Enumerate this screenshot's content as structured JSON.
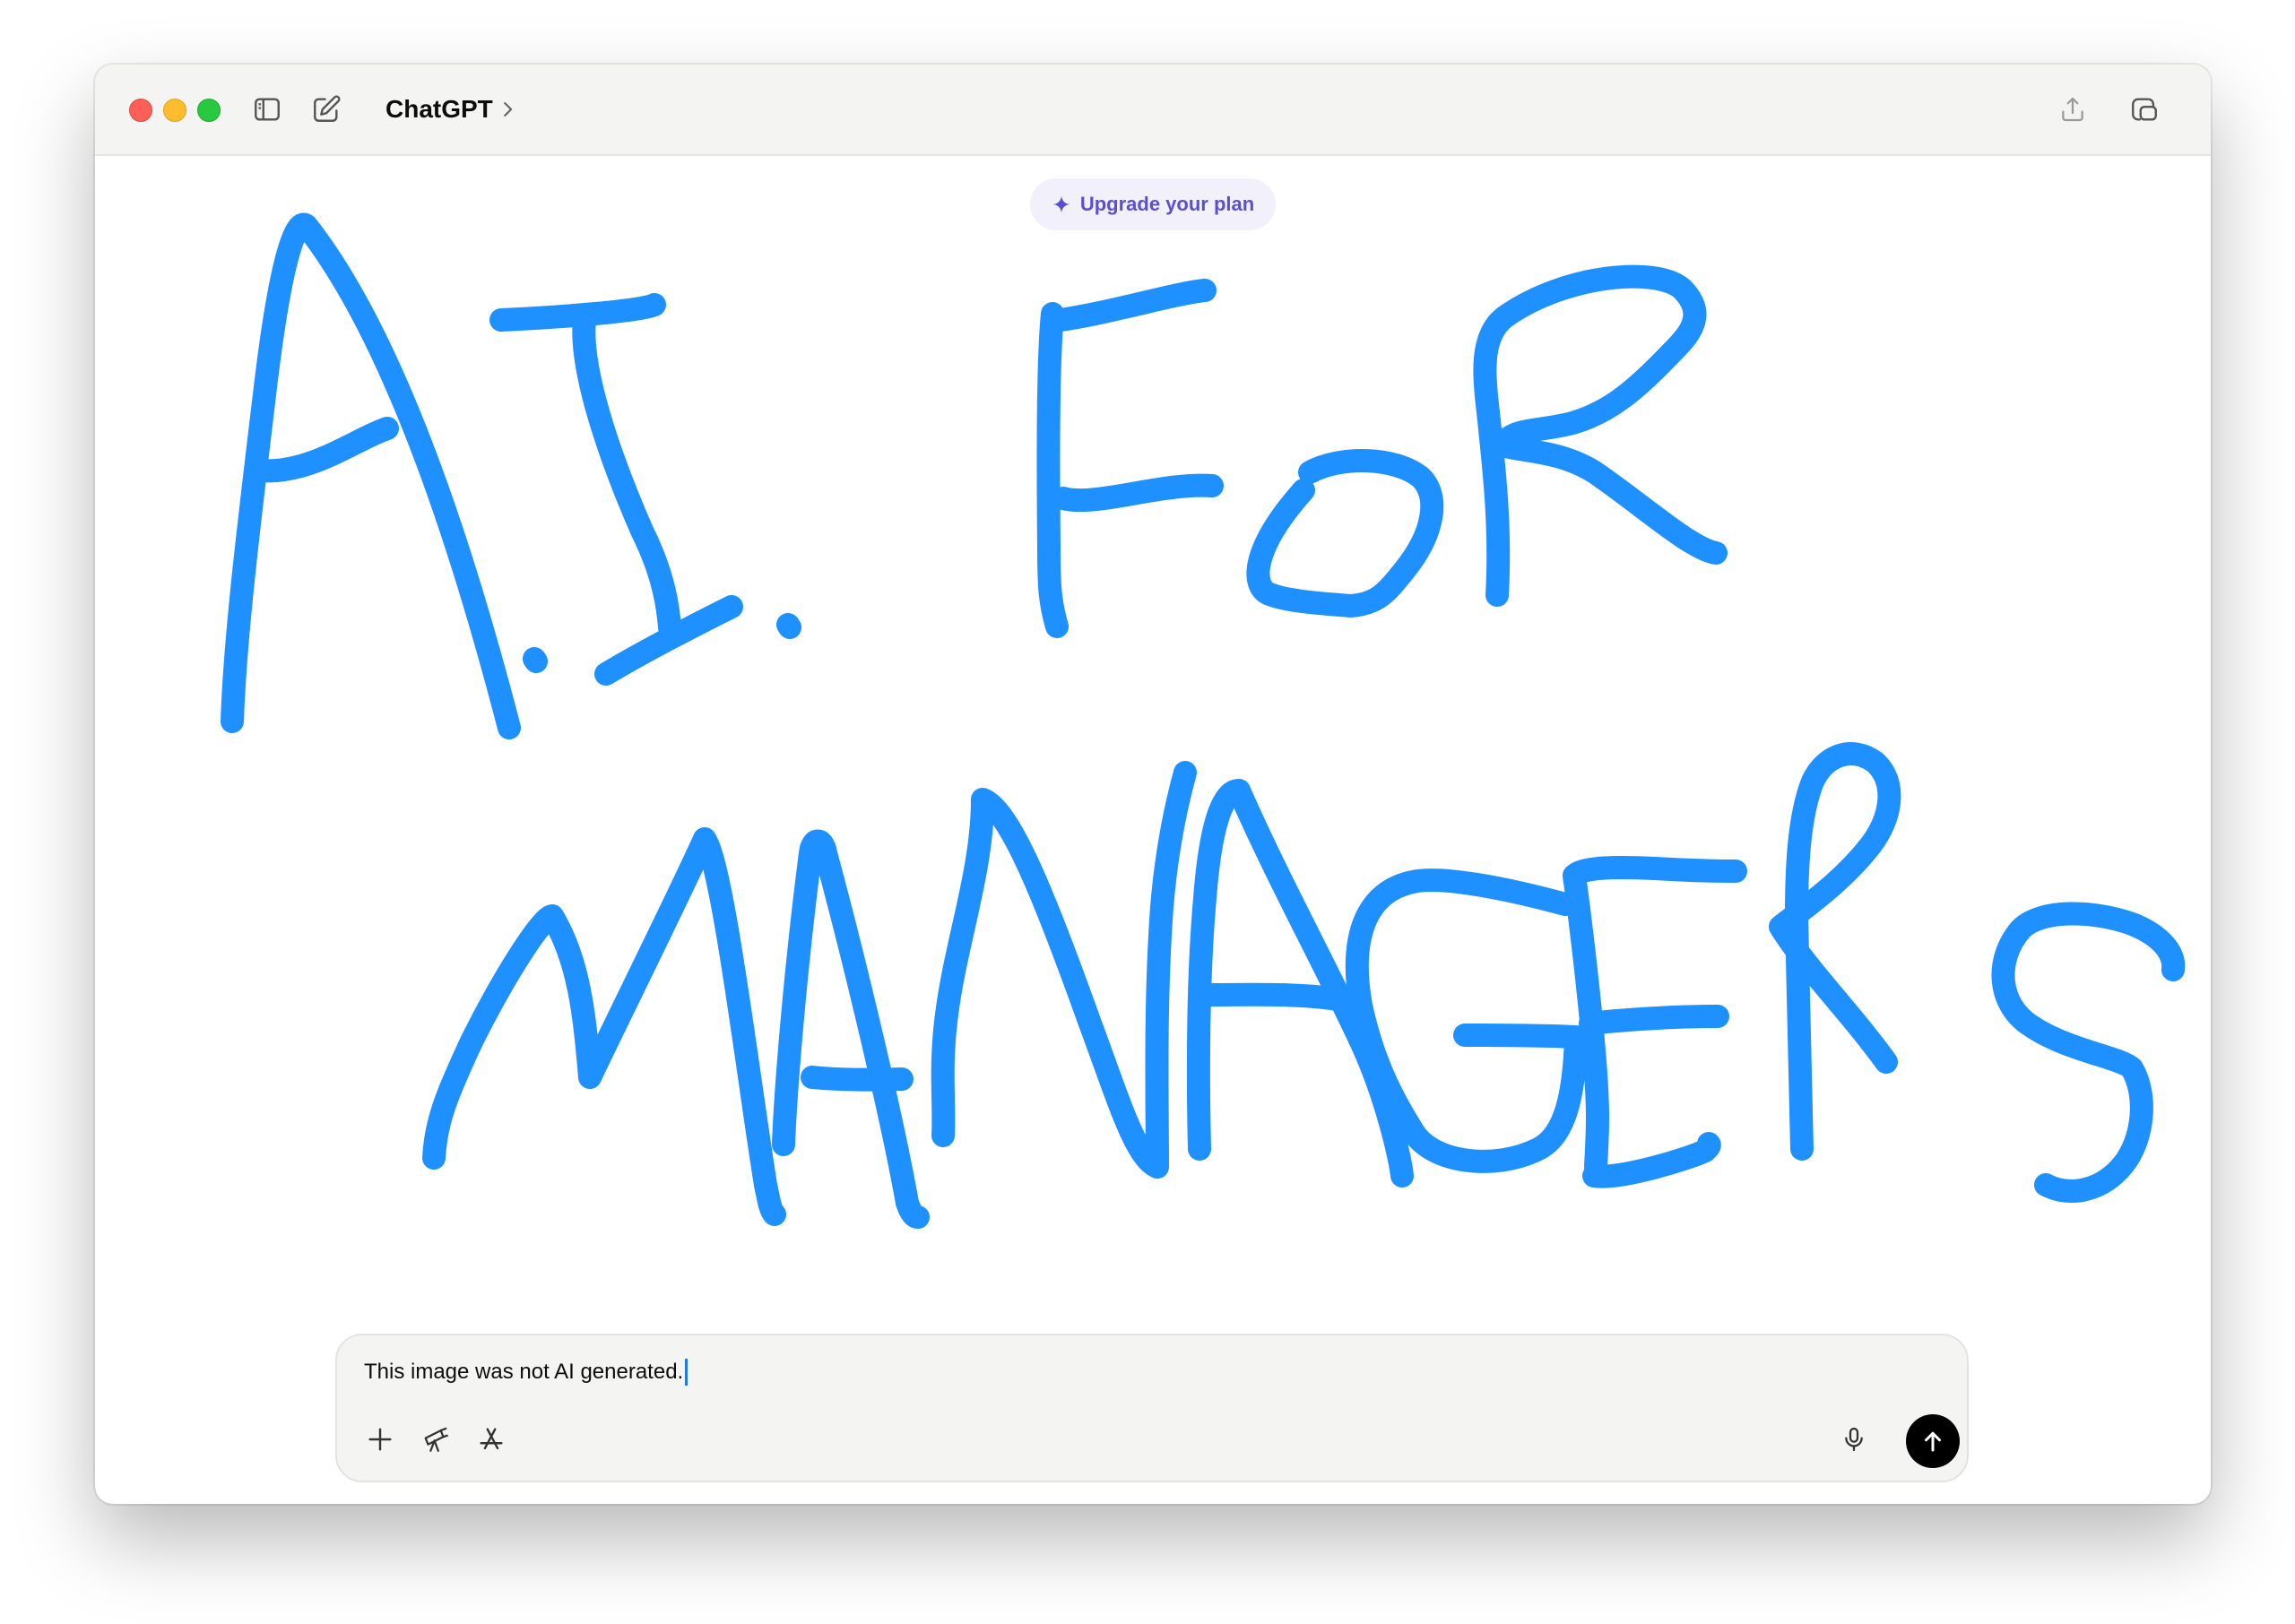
{
  "window": {
    "app_title": "ChatGPT"
  },
  "banner": {
    "upgrade_label": "Upgrade your plan"
  },
  "canvas": {
    "handwriting": "A.I. FOR MANAGERS",
    "stroke_color": "#1e90ff"
  },
  "composer": {
    "input_value": "This image was not AI generated."
  },
  "icons": {
    "sidebar_toggle": "sidebar-icon",
    "new_chat": "compose-icon",
    "title_chevron": "chevron-right-icon",
    "share": "share-icon",
    "window_mode": "window-icon",
    "sparkle": "sparkle-icon",
    "attach": "plus-icon",
    "tools": "telescope-icon",
    "apps": "app-store-icon",
    "voice": "microphone-icon",
    "send": "arrow-up-icon"
  },
  "colors": {
    "titlebar_bg": "#f4f4f3",
    "accent_purple": "#5a4fd0",
    "handwriting_blue": "#1e90ff",
    "send_button": "#000000"
  }
}
